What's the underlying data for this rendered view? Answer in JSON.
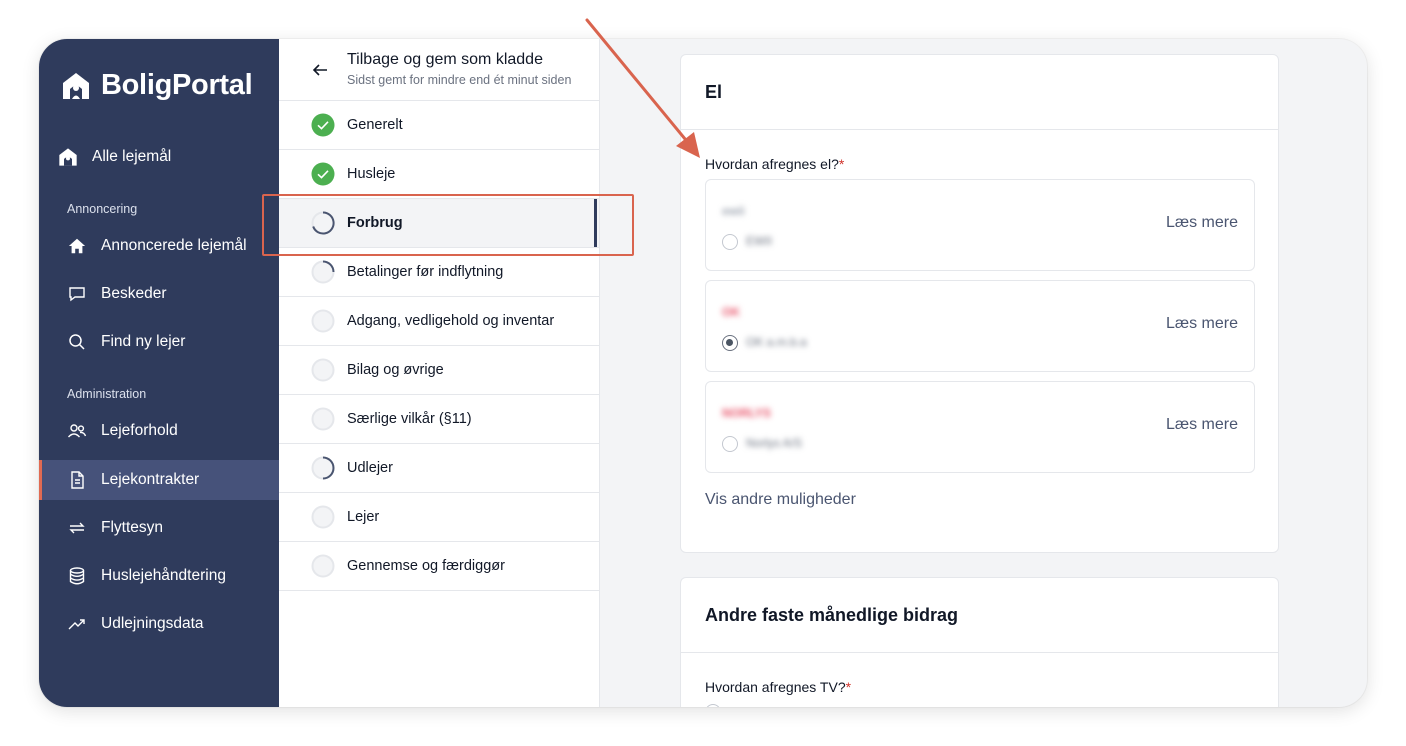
{
  "app": {
    "brand": "BoligPortal"
  },
  "sidebar": {
    "top_item": "Alle lejemål",
    "section_annoncering": "Annoncering",
    "section_administration": "Administration",
    "items": [
      {
        "label": "Annoncerede lejemål",
        "icon": "house-icon"
      },
      {
        "label": "Beskeder",
        "icon": "chat-icon"
      },
      {
        "label": "Find ny lejer",
        "icon": "search-icon"
      },
      {
        "label": "Lejeforhold",
        "icon": "users-icon"
      },
      {
        "label": "Lejekontrakter",
        "icon": "document-icon",
        "active": true
      },
      {
        "label": "Flyttesyn",
        "icon": "swap-arrows-icon"
      },
      {
        "label": "Huslejehåndtering",
        "icon": "database-icon"
      },
      {
        "label": "Udlejningsdata",
        "icon": "trend-up-icon"
      }
    ]
  },
  "steps": {
    "title": "Tilbage og gem som kladde",
    "subtitle": "Sidst gemt for mindre end ét minut siden",
    "items": [
      {
        "label": "Generelt",
        "status": "done"
      },
      {
        "label": "Husleje",
        "status": "done"
      },
      {
        "label": "Forbrug",
        "status": "active"
      },
      {
        "label": "Betalinger før indflytning",
        "status": "partial"
      },
      {
        "label": "Adgang, vedligehold og inventar",
        "status": "empty"
      },
      {
        "label": "Bilag og øvrige",
        "status": "empty"
      },
      {
        "label": "Særlige vilkår (§11)",
        "status": "empty"
      },
      {
        "label": "Udlejer",
        "status": "partial"
      },
      {
        "label": "Lejer",
        "status": "empty"
      },
      {
        "label": "Gennemse og færdiggør",
        "status": "empty"
      }
    ]
  },
  "el_card": {
    "title": "El",
    "question": "Hvordan afregnes el?",
    "required_mark": "*",
    "options": [
      {
        "name": "ewii",
        "sub": "EWII",
        "read_more": "Læs mere",
        "selected": false,
        "color": "#9ca3af"
      },
      {
        "name": "OK",
        "sub": "OK a.m.b.a",
        "read_more": "Læs mere",
        "selected": true,
        "color": "#e8546a"
      },
      {
        "name": "NORLYS",
        "sub": "Norlys A/S",
        "read_more": "Læs mere",
        "selected": false,
        "color": "#e8546a"
      }
    ],
    "show_more": "Vis andre muligheder"
  },
  "other_card": {
    "title": "Andre faste månedlige bidrag",
    "question": "Hvordan afregnes TV?",
    "required_mark": "*"
  },
  "colors": {
    "sidebar_bg": "#2f3b5c",
    "accent_red": "#d9644e",
    "check_green": "#4caf50"
  }
}
